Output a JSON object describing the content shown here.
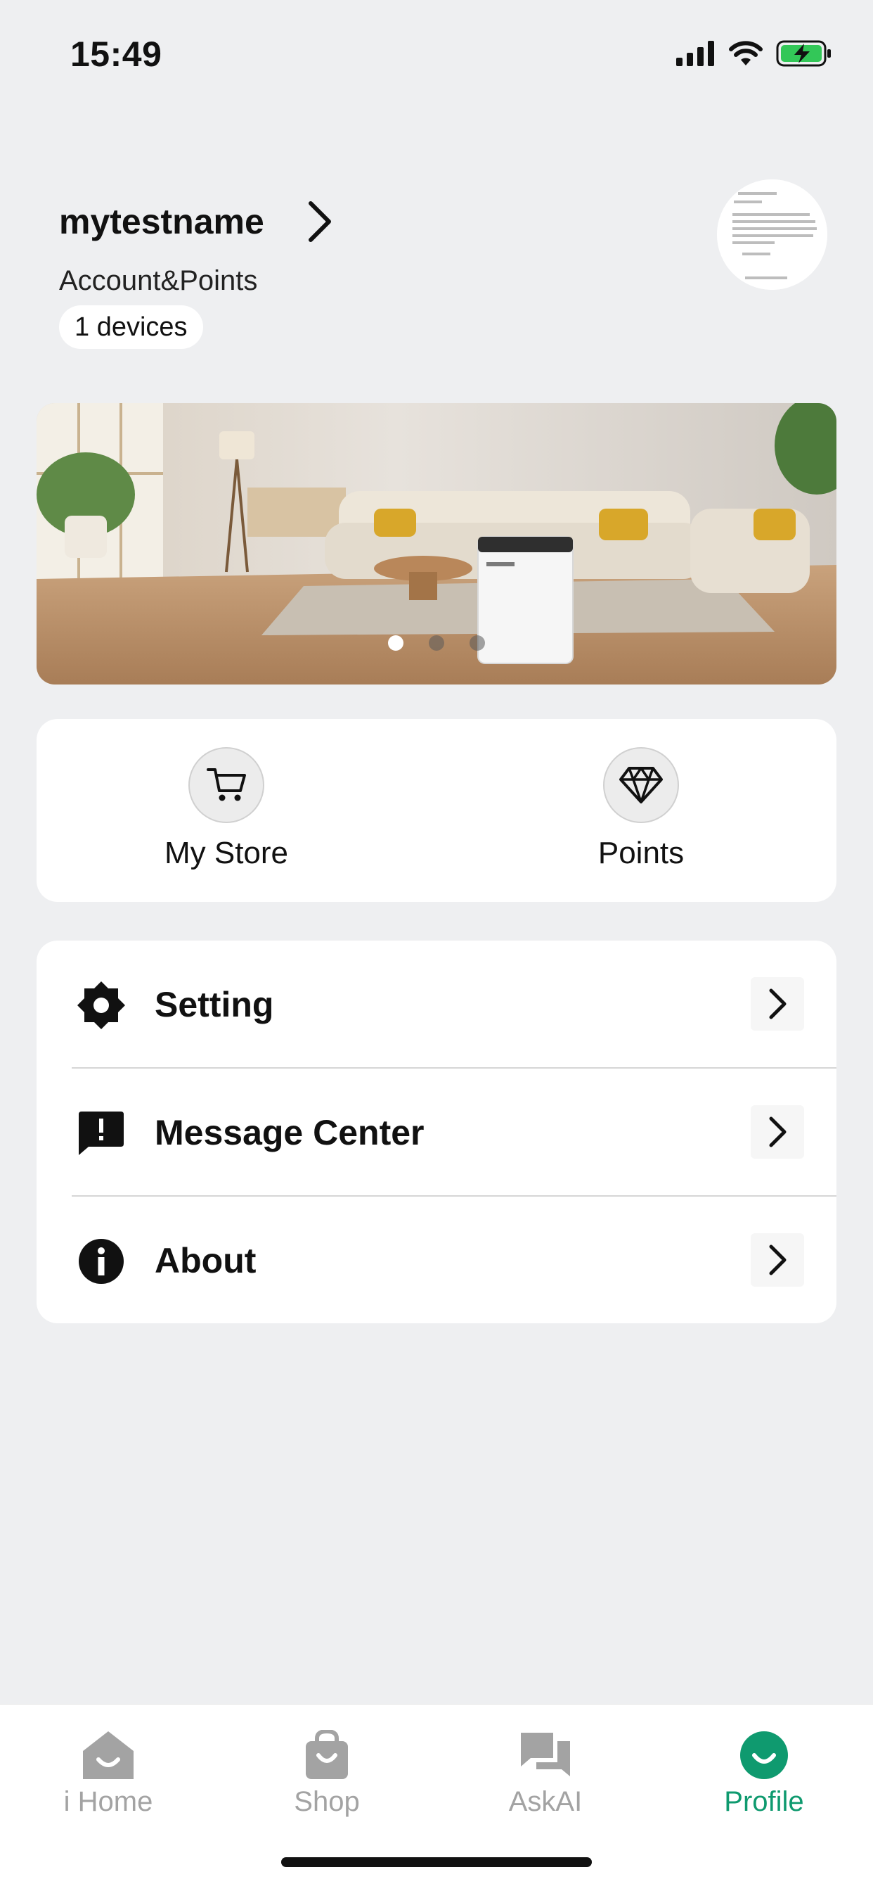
{
  "status_bar": {
    "time": "15:49"
  },
  "profile": {
    "username": "mytestname",
    "account_points_label": "Account&Points",
    "devices_label": "1 devices"
  },
  "banner": {
    "slide_count": 3,
    "active_slide": 1
  },
  "shortcuts": [
    {
      "label": "My Store",
      "icon": "cart-icon"
    },
    {
      "label": "Points",
      "icon": "diamond-icon"
    }
  ],
  "menu": [
    {
      "label": "Setting",
      "icon": "gear-icon"
    },
    {
      "label": "Message Center",
      "icon": "message-alert-icon"
    },
    {
      "label": "About",
      "icon": "info-icon"
    }
  ],
  "bottom_nav": {
    "active": "Profile",
    "items": [
      {
        "label": "i Home",
        "icon": "home-icon"
      },
      {
        "label": "Shop",
        "icon": "shopping-bag-icon"
      },
      {
        "label": "AskAI",
        "icon": "chat-icon"
      },
      {
        "label": "Profile",
        "icon": "profile-icon"
      }
    ]
  },
  "colors": {
    "accent": "#0f9a6f",
    "background": "#eeeff1",
    "inactive_nav": "#a3a3a3"
  }
}
